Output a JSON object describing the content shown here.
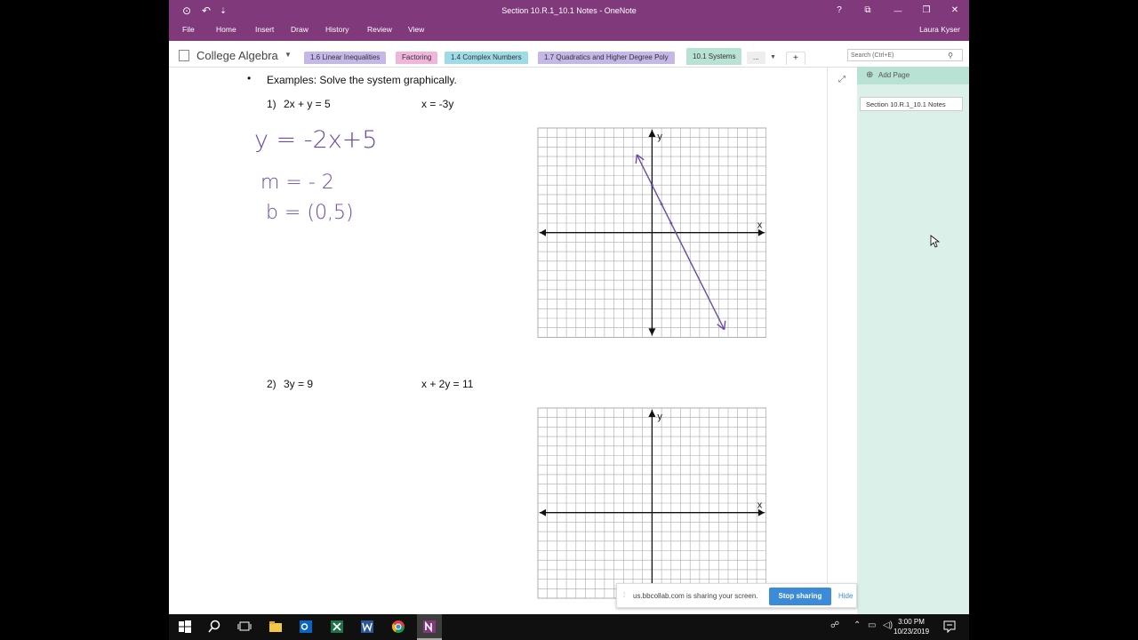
{
  "window": {
    "title": "Section 10.R.1_10.1 Notes - OneNote",
    "help": "?",
    "ribbon_toggle": "⧉",
    "minimize": "—",
    "restore": "❐",
    "close": "✕",
    "back_icon": "⊙",
    "undo_icon": "↶",
    "qat_more": "⇣"
  },
  "ribbon": {
    "tabs": [
      "File",
      "Home",
      "Insert",
      "Draw",
      "History",
      "Review",
      "View"
    ],
    "user": "Laura Kyser"
  },
  "notebook": {
    "title": "College Algebra",
    "sections": [
      {
        "label": "1.6 Linear Inequalities",
        "color": "#c5b8e8"
      },
      {
        "label": "Factoring",
        "color": "#f0b6d9"
      },
      {
        "label": "1.4 Complex Numbers",
        "color": "#9fdbe7"
      },
      {
        "label": "1.7 Quadratics and Higher Degree Poly",
        "color": "#c5b8e8"
      },
      {
        "label": "10.1 Systems",
        "color": "#b7e2d4"
      }
    ],
    "more": "...",
    "add": "+",
    "search_placeholder": "Search (Ctrl+E)"
  },
  "page": {
    "bullet": "•",
    "heading": "Examples:  Solve the system graphically.",
    "problem1": {
      "num": "1)",
      "eq1": "2x + y = 5",
      "eq2": "x = -3y"
    },
    "problem2": {
      "num": "2)",
      "eq1": "3y = 9",
      "eq2": "x + 2y = 11"
    },
    "handwriting": [
      "y = -2x+5",
      "m = - 2",
      "b = (0,5)"
    ],
    "ink_color": "#6a4aa8",
    "axis_x": "x",
    "axis_y": "y"
  },
  "pages_pane": {
    "add_page": "Add Page",
    "pages": [
      "Section 10.R.1_10.1 Notes"
    ]
  },
  "share": {
    "text": "us.bbcollab.com is sharing your screen.",
    "stop": "Stop sharing",
    "hide": "Hide"
  },
  "taskbar": {
    "time": "3:00 PM",
    "date": "10/23/2019"
  }
}
